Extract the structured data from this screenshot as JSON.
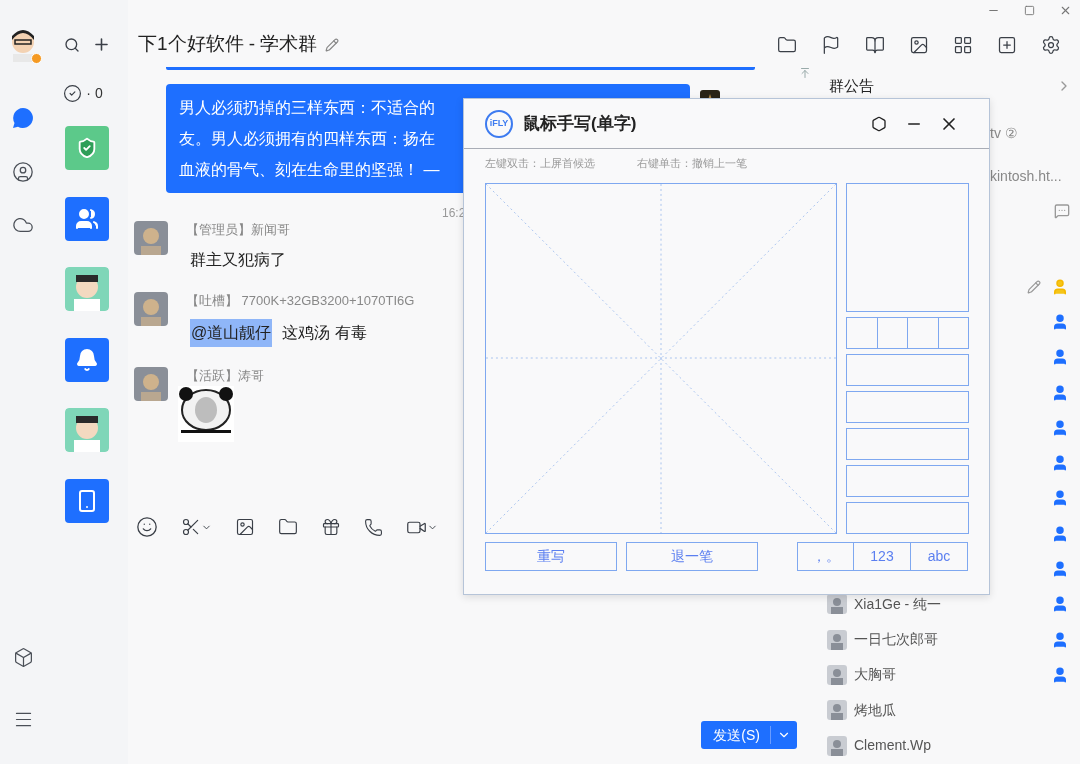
{
  "nav": {
    "items": [
      {
        "kind": "chat",
        "selected": true
      },
      {
        "kind": "contacts",
        "selected": false
      },
      {
        "kind": "cloud",
        "selected": false
      }
    ]
  },
  "conversations": {
    "done_count": "· 0",
    "items": [
      {
        "kind": "shield",
        "selected": false
      },
      {
        "kind": "group",
        "selected": false
      },
      {
        "kind": "avatar",
        "selected": false
      },
      {
        "kind": "bell",
        "selected": false
      },
      {
        "kind": "avatar",
        "selected": false
      },
      {
        "kind": "phone",
        "selected": false
      }
    ]
  },
  "chat": {
    "title": "下1个好软件 - 学术群",
    "own_message": {
      "lines": [
        "男人必须扔掉的三样东西：不适合的",
        "友。男人必须拥有的四样东西：扬在",
        "血液的骨气、刻在生命里的坚强！ —"
      ]
    },
    "time": "16:2",
    "messages": [
      {
        "kind": "text",
        "sender": "【管理员】新闻哥",
        "text": "群主又犯病了"
      },
      {
        "kind": "mention",
        "sender": "【吐槽】 7700K+32GB3200+1070TI6G",
        "mention": "@道山靓仔",
        "text": "这鸡汤 有毒"
      },
      {
        "kind": "sticker",
        "sender": "【活跃】涛哥"
      }
    ],
    "send_button": "发送(S)"
  },
  "group_panel": {
    "title": "群公告",
    "announcement_lines": [
      "tv ②",
      "kintosh.ht..."
    ],
    "members": [
      {
        "kind": "owner"
      },
      {
        "kind": "admin"
      },
      {
        "kind": "admin"
      },
      {
        "kind": "admin"
      },
      {
        "kind": "admin"
      },
      {
        "kind": "admin"
      },
      {
        "kind": "admin"
      },
      {
        "kind": "admin"
      },
      {
        "kind": "admin"
      },
      {
        "name": "Xia1Ge - 纯一",
        "kind": "admin"
      },
      {
        "name": "一日七次郎哥",
        "kind": "admin"
      },
      {
        "name": "大胸哥",
        "kind": "admin"
      },
      {
        "name": "烤地瓜",
        "kind": "member"
      },
      {
        "name": "Clement.Wp",
        "kind": "member"
      }
    ]
  },
  "handwriting": {
    "logo": "iFLY",
    "title": "鼠标手写(单字)",
    "hints": [
      "左键双击：上屏首候选",
      "右键单击：撤销上一笔"
    ],
    "buttons": [
      "重写",
      "退一笔"
    ],
    "modes": [
      "，。",
      "123",
      "abc"
    ]
  }
}
